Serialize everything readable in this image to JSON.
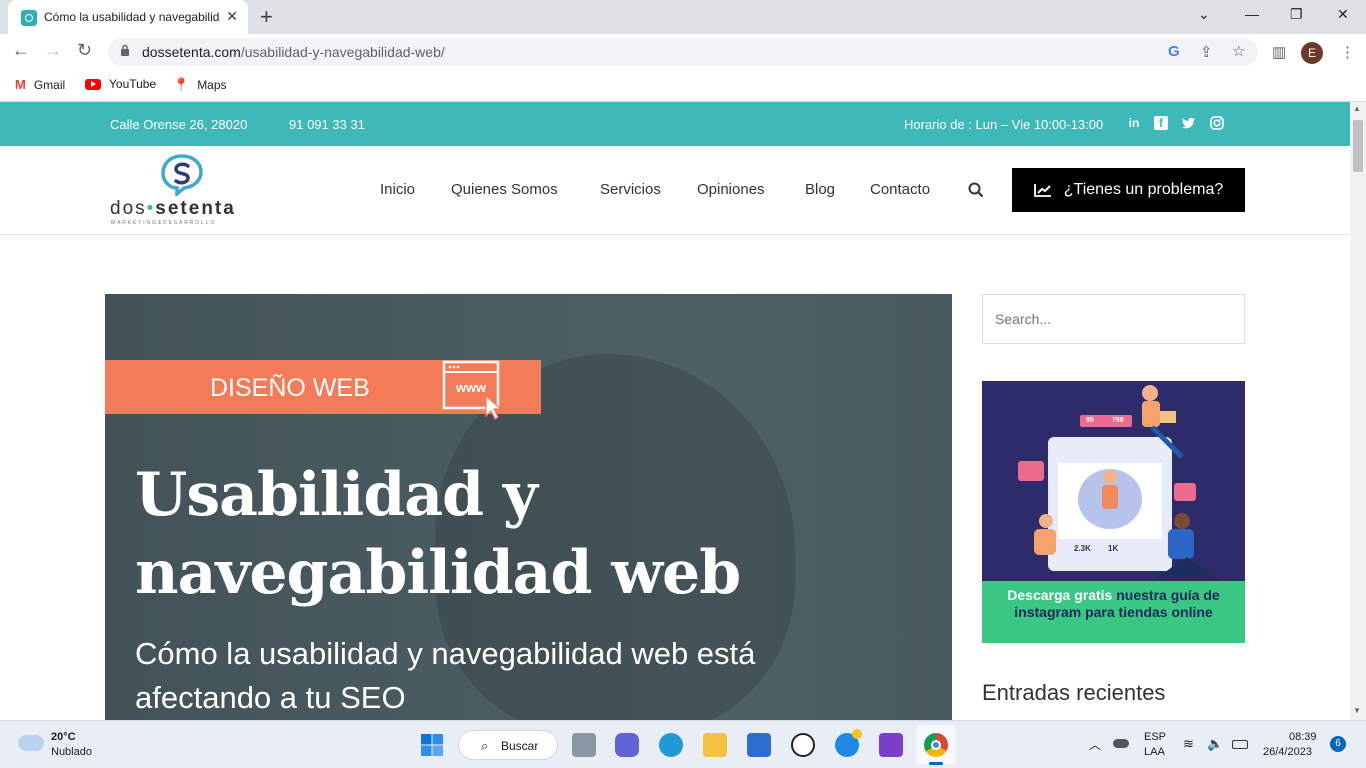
{
  "browser": {
    "tab_title": "Cómo la usabilidad y navegabilidad",
    "url_domain": "dossetenta.com",
    "url_path": "/usabilidad-y-navegabilidad-web/",
    "profile_initial": "E",
    "bookmarks": [
      "Gmail",
      "YouTube",
      "Maps"
    ]
  },
  "topbar": {
    "address": "Calle Orense 26, 28020",
    "phone": "91 091 33 31",
    "hours": "Horario de : Lun – Vie 10:00-13:00"
  },
  "header": {
    "logo_text_a": "dos",
    "logo_text_b": "setenta",
    "logo_tagline": "MARKETING&DESARROLLO",
    "nav": [
      "Inicio",
      "Quienes Somos",
      "Servicios",
      "Opiniones",
      "Blog",
      "Contacto"
    ],
    "cta_label": "¿Tienes un problema?"
  },
  "hero": {
    "badge": "DISEÑO WEB",
    "badge_icon_text": "www",
    "title": "Usabilidad y navegabilidad web",
    "subtitle": "Cómo la usabilidad y navegabilidad web está afectando a tu SEO"
  },
  "sidebar": {
    "search_placeholder": "Search...",
    "promo_highlight": "Descarga gratis",
    "promo_text": " nuestra guía de instagram para tiendas online",
    "promo_stats": [
      "95",
      "758",
      "2.3K",
      "1K"
    ],
    "recent_title": "Entradas recientes"
  },
  "taskbar": {
    "weather_temp": "20°C",
    "weather_desc": "Nublado",
    "search_label": "Buscar",
    "lang_a": "ESP",
    "lang_b": "LAA",
    "time": "08:39",
    "date": "26/4/2023",
    "notif_count": "6"
  },
  "colors": {
    "teal": "#3fb8b9",
    "coral": "#f47b58",
    "navy": "#2e2b6b",
    "green": "#39c783"
  }
}
